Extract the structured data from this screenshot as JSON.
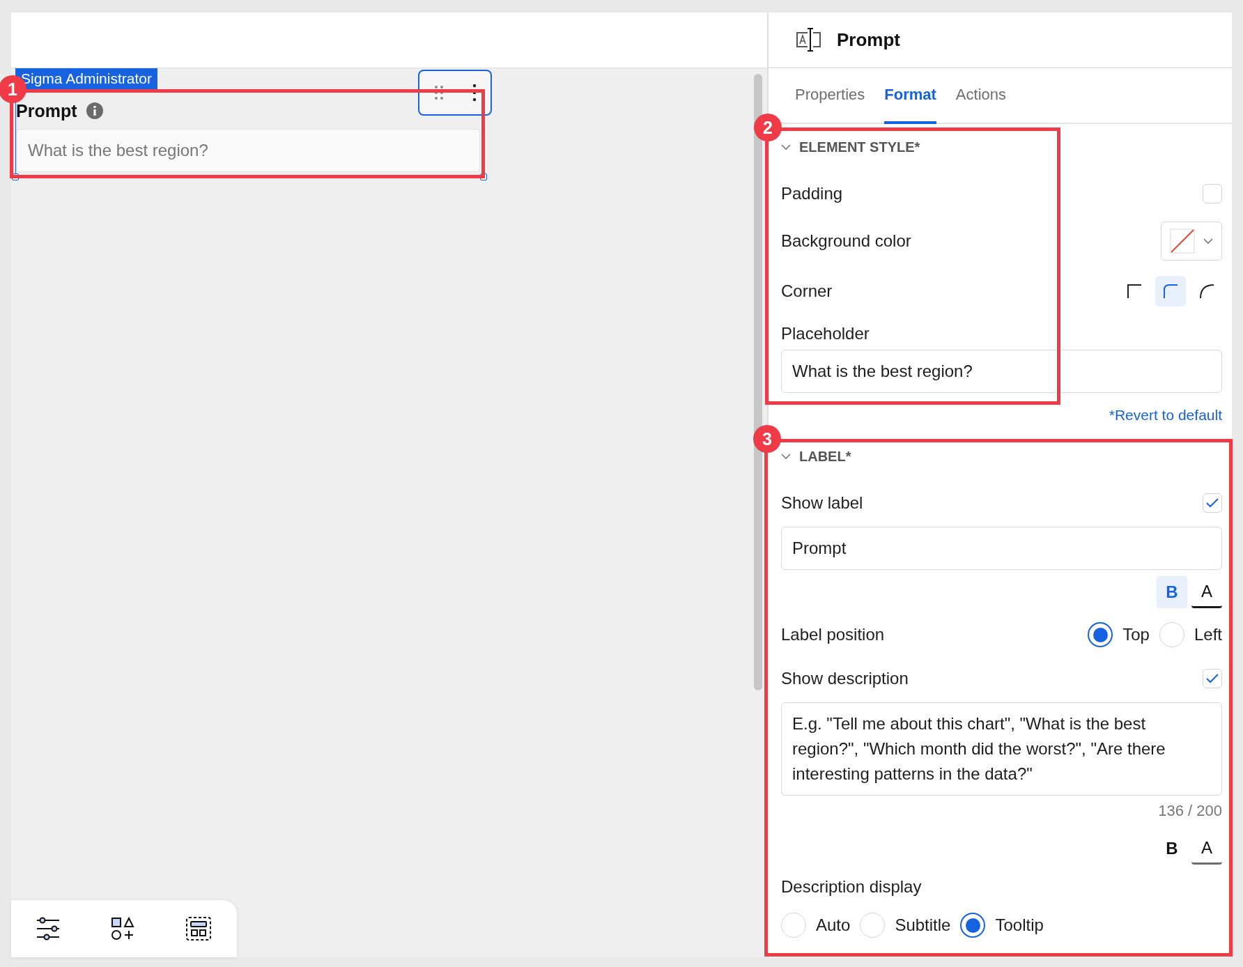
{
  "canvas": {
    "user_tag": "Sigma Administrator",
    "element": {
      "label": "Prompt",
      "placeholder": "What is the best region?"
    }
  },
  "panel": {
    "title": "Prompt",
    "tabs": [
      {
        "label": "Properties",
        "selected": false
      },
      {
        "label": "Format",
        "selected": true
      },
      {
        "label": "Actions",
        "selected": false
      }
    ],
    "sections": [
      {
        "title": "ELEMENT STYLE*",
        "expanded": true,
        "rows": [
          {
            "kind": "checkbox",
            "label": "Padding",
            "checked": false
          },
          {
            "kind": "color",
            "label": "Background color"
          },
          {
            "kind": "corner",
            "label": "Corner",
            "options": [
              {
                "kind": "square",
                "selected": false
              },
              {
                "kind": "rounded",
                "selected": true
              },
              {
                "kind": "round",
                "selected": false
              }
            ]
          },
          {
            "kind": "caption",
            "label": "Placeholder"
          },
          {
            "kind": "field",
            "value": "What is the best region?"
          },
          {
            "kind": "link",
            "label": "*Revert to default"
          }
        ]
      },
      {
        "title": "LABEL*",
        "expanded": true,
        "rows": [
          {
            "kind": "checkbox",
            "label": "Show label",
            "checked": true
          },
          {
            "kind": "field",
            "value": "Prompt"
          },
          {
            "kind": "styles",
            "buttons": [
              {
                "kind": "bold",
                "text": "B",
                "selected": true
              },
              {
                "kind": "color",
                "text": "A",
                "color": "#1a1a1a"
              }
            ]
          },
          {
            "kind": "radio",
            "label": "Label position",
            "options": [
              {
                "label": "Top",
                "selected": true
              },
              {
                "label": "Left",
                "selected": false
              }
            ]
          },
          {
            "kind": "checkbox",
            "label": "Show description",
            "checked": true
          },
          {
            "kind": "textarea",
            "value": "E.g. \"Tell me about this chart\", \"What is the best region?\", \"Which month did the worst?\", \"Are there interesting patterns in the data?\""
          },
          {
            "kind": "counter",
            "label": "136 / 200"
          },
          {
            "kind": "styles",
            "buttons": [
              {
                "kind": "bold",
                "text": "B",
                "selected": false
              },
              {
                "kind": "color",
                "text": "A",
                "color": "#6b6b6b"
              }
            ]
          },
          {
            "kind": "caption",
            "label": "Description display"
          },
          {
            "kind": "radio",
            "options": [
              {
                "label": "Auto",
                "selected": false
              },
              {
                "label": "Subtitle",
                "selected": false
              },
              {
                "label": "Tooltip",
                "selected": true
              }
            ]
          }
        ]
      }
    ]
  },
  "annotations": [
    {
      "number": "1"
    },
    {
      "number": "2"
    },
    {
      "number": "3"
    }
  ]
}
